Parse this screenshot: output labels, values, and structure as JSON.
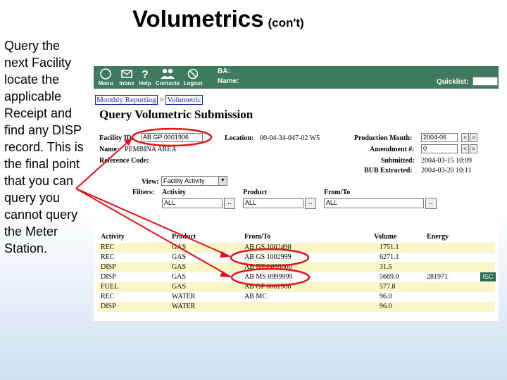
{
  "slide": {
    "title": "Volumetrics",
    "title_suffix": "(con't)",
    "side_text": "Query the next Facility locate the applicable Receipt and find any DISP record. This is the final point that you can query you cannot query the Meter Station."
  },
  "toolbar": {
    "menu": "Menu",
    "inbox": "Inbox",
    "help": "Help",
    "contacts": "Contacts",
    "logout": "Logout",
    "ba_label": "BA:",
    "name_label": "Name:",
    "quicklist_label": "Quicklist:"
  },
  "breadcrumb": {
    "item1": "Monthly Reporting",
    "separator": ">",
    "item2": "Volumetric"
  },
  "page_title": "Query Volumetric Submission",
  "form": {
    "facility_id_label": "Facility ID:",
    "facility_id_value": "AB GP 0001906",
    "location_label": "Location:",
    "location_value": "00-04-34-047-02 W5",
    "production_month_label": "Production Month:",
    "production_month_value": "2004-06",
    "name_label": "Name:",
    "name_value": "PEMBINA AREA",
    "amendment_label": "Amendment #:",
    "amendment_value": "0",
    "reference_code_label": "Reference Code:",
    "submitted_label": "Submitted:",
    "submitted_value": "2004-03-15 10:09",
    "bub_label": "BUB Extracted:",
    "bub_value": "2004-03-20 10:11",
    "view_label": "View:",
    "view_value": "Facility Activity",
    "filters_label": "Filters:",
    "activity_label": "Activity",
    "activity_value": "ALL",
    "product_label": "Product",
    "product_value": "ALL",
    "fromto_label": "From/To",
    "fromto_value": "ALL",
    "dots": "..",
    "prev": "<",
    "next": ">"
  },
  "table": {
    "headers": [
      "Activity",
      "Product",
      "From/To",
      "Volume",
      "Energy"
    ],
    "rows": [
      {
        "activity": "REC",
        "product": "GAS",
        "fromto": "AB GS 1002498",
        "volume": "1751.1",
        "energy": ""
      },
      {
        "activity": "REC",
        "product": "GAS",
        "fromto": "AB GS 1002999",
        "volume": "6271.1",
        "energy": ""
      },
      {
        "activity": "DISP",
        "product": "GAS",
        "fromto": "AB BT E053000",
        "volume": "31.5",
        "energy": ""
      },
      {
        "activity": "DISP",
        "product": "GAS",
        "fromto": "AB MS 0999999",
        "volume": "5669.0",
        "energy": "281971",
        "button": "ISC"
      },
      {
        "activity": "FUEL",
        "product": "GAS",
        "fromto": "AB GP 0001906",
        "volume": "577.8",
        "energy": ""
      },
      {
        "activity": "REC",
        "product": "WATER",
        "fromto": "AB MC",
        "volume": "96.0",
        "energy": ""
      },
      {
        "activity": "DISP",
        "product": "WATER",
        "fromto": "",
        "volume": "96.0",
        "energy": ""
      }
    ]
  },
  "colors": {
    "toolbar_bg": "#3d7a5e",
    "row_highlight": "#fbf6c8",
    "annotation_red": "#e0131b",
    "link_blue": "#1a2fa8"
  }
}
